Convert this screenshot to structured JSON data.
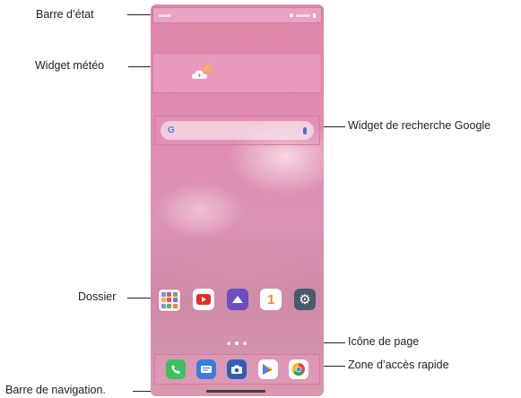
{
  "callouts": {
    "status_bar": "Barre d’état",
    "weather_widget": "Widget météo",
    "google_search_widget": "Widget de recherche Google",
    "folder": "Dossier",
    "page_icon": "Icône de page",
    "quick_access_area": "Zone d’accès rapide",
    "navigation_bar": "Barre de navigation."
  },
  "search": {
    "logo_letter": "G"
  },
  "apps": [
    {
      "icon": "folder-icon"
    },
    {
      "icon": "youtube-icon"
    },
    {
      "icon": "gallery-icon"
    },
    {
      "icon": "number-one-icon",
      "glyph": "1"
    },
    {
      "icon": "settings-icon",
      "glyph": "⚙"
    }
  ],
  "dock": [
    {
      "icon": "phone-icon",
      "color": "#3fbf5f"
    },
    {
      "icon": "messages-icon",
      "color": "#3b7be0"
    },
    {
      "icon": "camera-icon",
      "color": "#2f5fb5"
    },
    {
      "icon": "play-store-icon",
      "color": "#ffffff"
    },
    {
      "icon": "chrome-icon",
      "color": "#ffffff"
    }
  ],
  "colors": {
    "wallpaper": "#de86aa",
    "highlight_border": "#d57da3"
  }
}
